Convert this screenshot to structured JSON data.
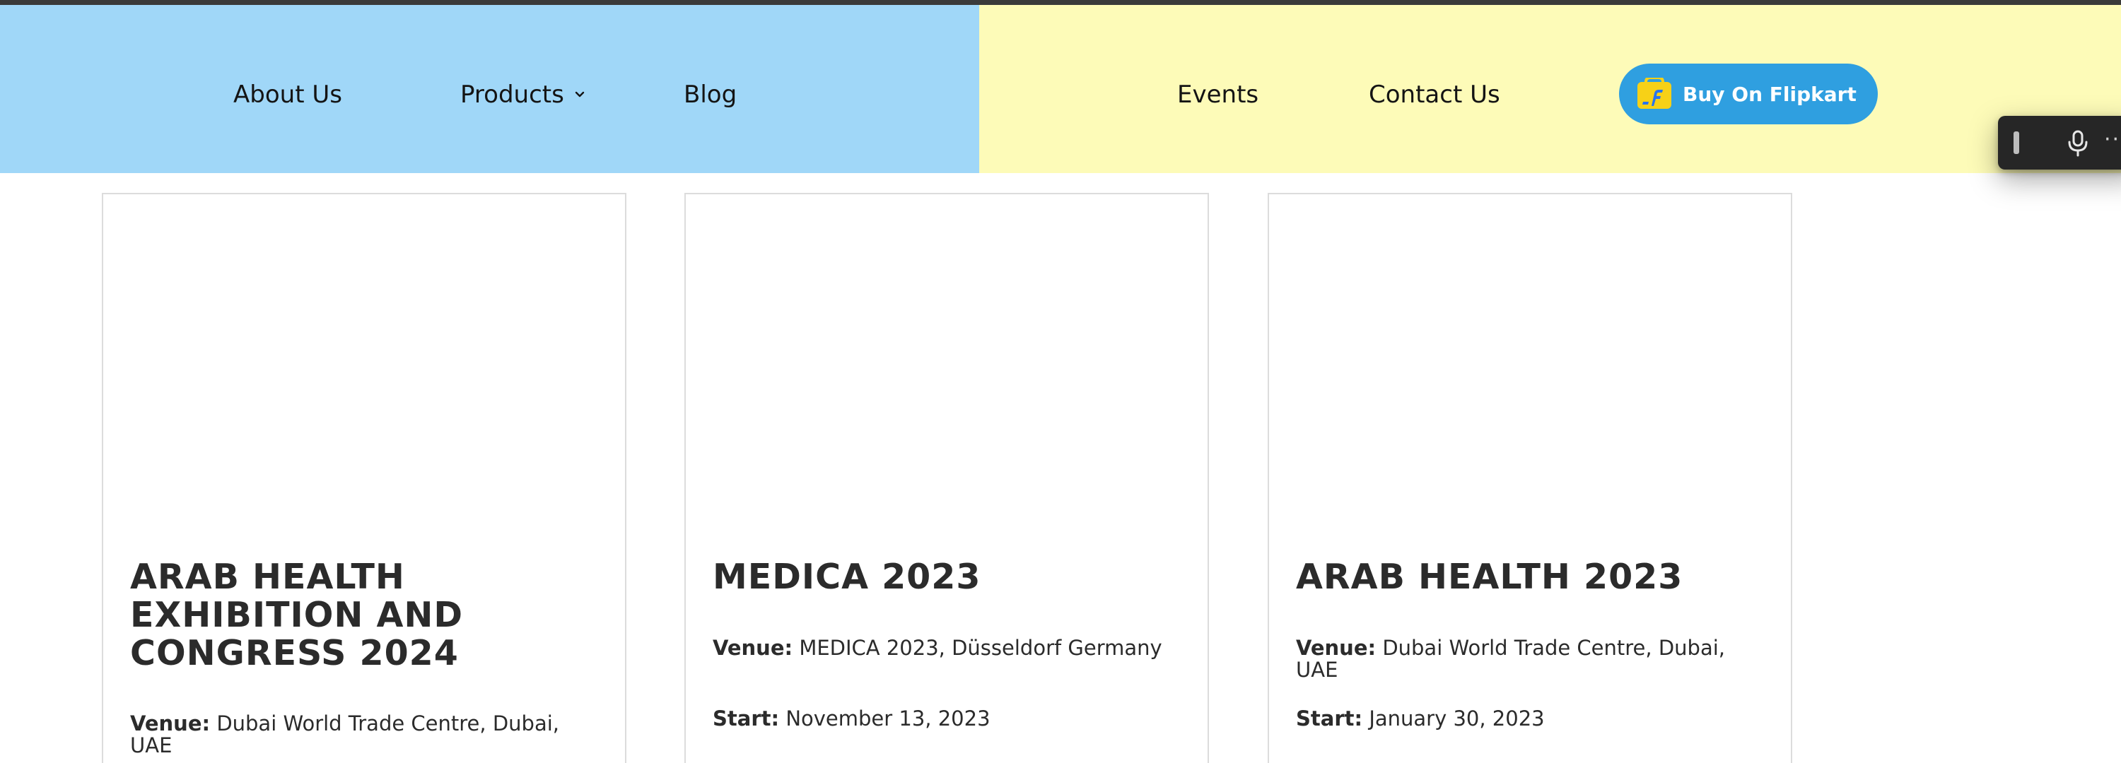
{
  "nav": {
    "about_label": "About Us",
    "products_label": "Products",
    "blog_label": "Blog",
    "events_label": "Events",
    "contact_label": "Contact Us",
    "cta_label": "Buy On Flipkart"
  },
  "toolbar": {
    "more_label": "··"
  },
  "events": [
    {
      "title": "ARAB HEALTH EXHIBITION AND CONGRESS 2024",
      "venue_label": "Venue:",
      "venue": "Dubai World Trade Centre, Dubai, UAE"
    },
    {
      "title": "MEDICA 2023",
      "venue_label": "Venue:",
      "venue": "MEDICA 2023, Düsseldorf Germany",
      "start_label": "Start:",
      "start": "November 13, 2023"
    },
    {
      "title": "ARAB HEALTH 2023",
      "venue_label": "Venue:",
      "venue": "Dubai World Trade Centre, Dubai, UAE",
      "start_label": "Start:",
      "start": "January 30, 2023"
    }
  ],
  "colors": {
    "header_left_bg": "#a0d7f8",
    "header_right_bg": "#fdfbb8",
    "cta_bg": "#2f9fe0",
    "flipkart_yellow": "#f7d117",
    "flipkart_blue": "#2874f0"
  },
  "icons": {
    "products_dropdown": "chevron-down-icon",
    "cta": "flipkart-logo-icon",
    "toolbar_drag": "drag-handle-icon",
    "toolbar_mic": "microphone-icon",
    "toolbar_more": "more-icon"
  }
}
